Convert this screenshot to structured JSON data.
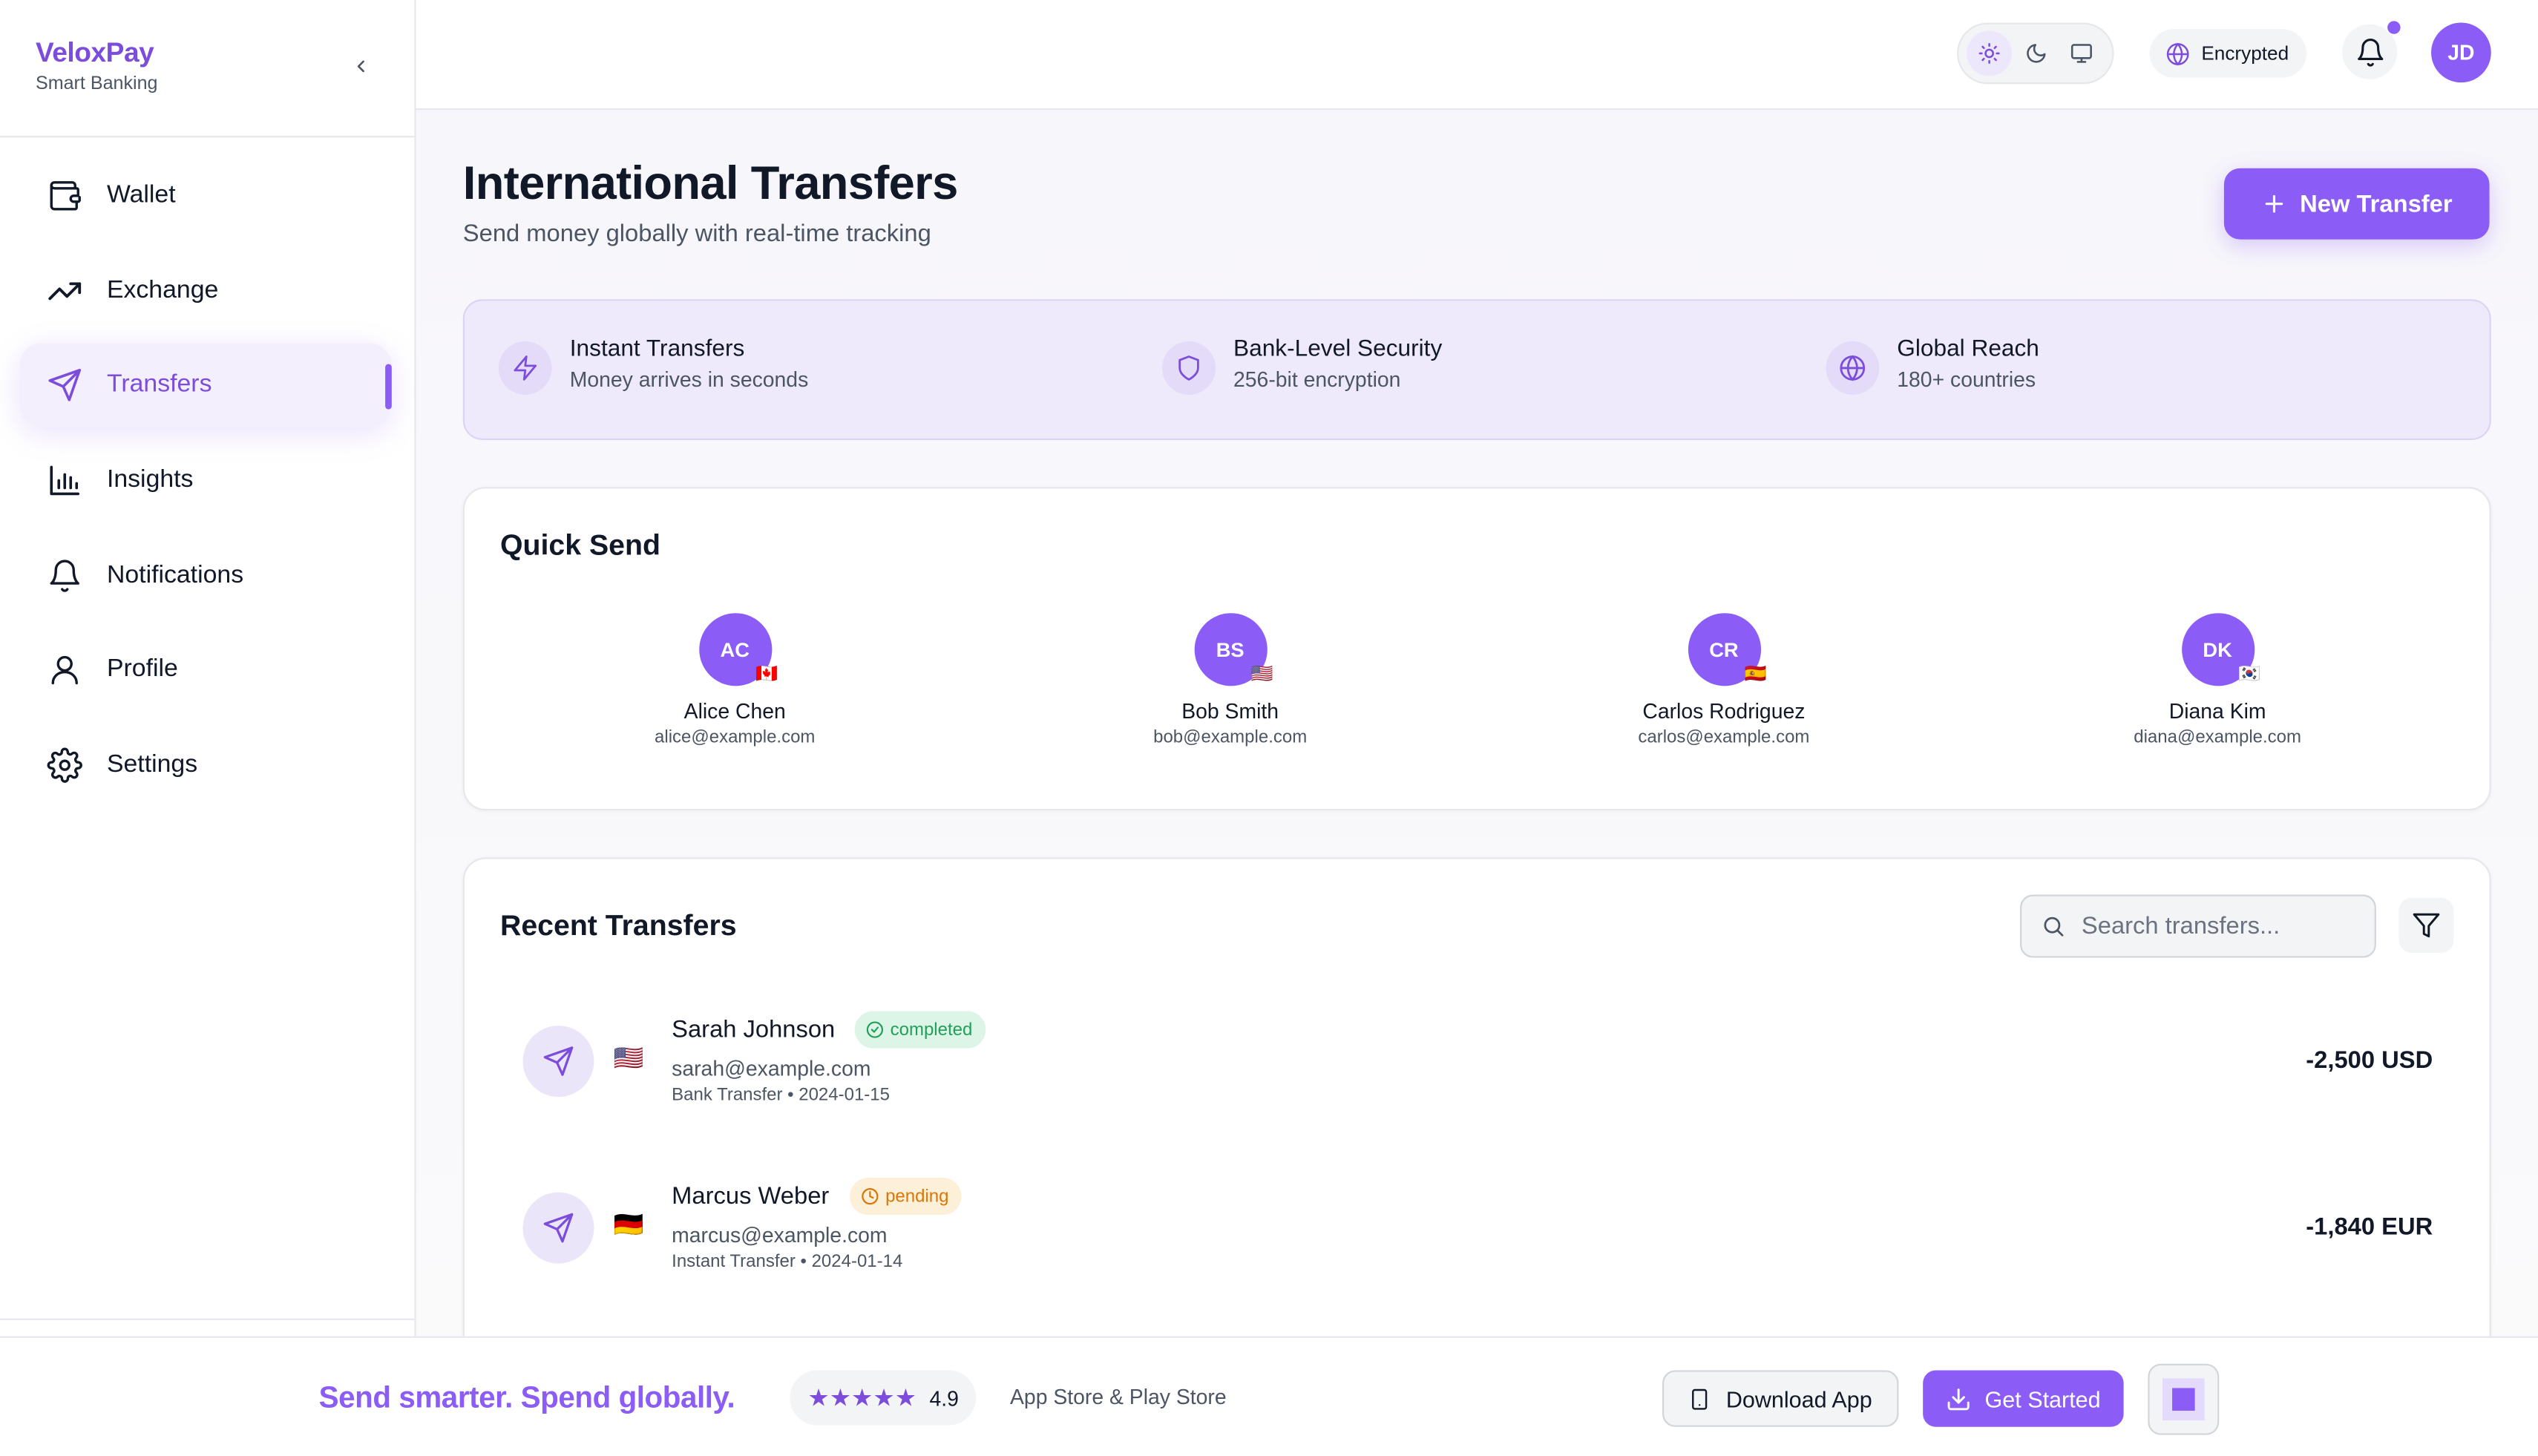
{
  "brand": {
    "name": "VeloxPay",
    "tagline": "Smart Banking"
  },
  "sidebar": {
    "items": [
      {
        "label": "Wallet",
        "icon": "wallet-icon",
        "active": false
      },
      {
        "label": "Exchange",
        "icon": "trending-up-icon",
        "active": false
      },
      {
        "label": "Transfers",
        "icon": "send-icon",
        "active": true
      },
      {
        "label": "Insights",
        "icon": "bar-chart-icon",
        "active": false
      },
      {
        "label": "Notifications",
        "icon": "bell-icon",
        "active": false
      },
      {
        "label": "Profile",
        "icon": "user-icon",
        "active": false
      },
      {
        "label": "Settings",
        "icon": "gear-icon",
        "active": false
      }
    ]
  },
  "topbar": {
    "theme_options": [
      "light",
      "dark",
      "system"
    ],
    "theme_selected": "light",
    "security_label": "Encrypted",
    "has_unread_notifications": true,
    "user_initials": "JD"
  },
  "header": {
    "title": "International Transfers",
    "subtitle": "Send money globally with real-time tracking",
    "new_transfer_label": "New Transfer"
  },
  "features": [
    {
      "title": "Instant Transfers",
      "subtitle": "Money arrives in seconds",
      "icon": "zap-icon"
    },
    {
      "title": "Bank-Level Security",
      "subtitle": "256-bit encryption",
      "icon": "shield-icon"
    },
    {
      "title": "Global Reach",
      "subtitle": "180+ countries",
      "icon": "globe-icon"
    }
  ],
  "quick_send": {
    "title": "Quick Send",
    "contacts": [
      {
        "initials": "AC",
        "name": "Alice Chen",
        "email": "alice@example.com",
        "flag": "🇨🇦"
      },
      {
        "initials": "BS",
        "name": "Bob Smith",
        "email": "bob@example.com",
        "flag": "🇺🇸"
      },
      {
        "initials": "CR",
        "name": "Carlos Rodriguez",
        "email": "carlos@example.com",
        "flag": "🇪🇸"
      },
      {
        "initials": "DK",
        "name": "Diana Kim",
        "email": "diana@example.com",
        "flag": "🇰🇷"
      }
    ]
  },
  "recent": {
    "title": "Recent Transfers",
    "search_placeholder": "Search transfers...",
    "transfers": [
      {
        "name": "Sarah Johnson",
        "status": "completed",
        "email": "sarah@example.com",
        "meta": "Bank Transfer • 2024-01-15",
        "amount": "-2,500 USD",
        "flag": "🇺🇸"
      },
      {
        "name": "Marcus Weber",
        "status": "pending",
        "email": "marcus@example.com",
        "meta": "Instant Transfer • 2024-01-14",
        "amount": "-1,840 EUR",
        "flag": "🇩🇪"
      }
    ]
  },
  "footer": {
    "slogan": "Send smarter. Spend globally.",
    "stars": "★★★★★",
    "rating": "4.9",
    "stores": "App Store & Play Store",
    "download_label": "Download App",
    "get_started_label": "Get Started"
  },
  "colors": {
    "accent": "#8b5cf6",
    "accent_dark": "#7c4ddb",
    "completed": "#22a05a",
    "pending": "#d97706"
  }
}
